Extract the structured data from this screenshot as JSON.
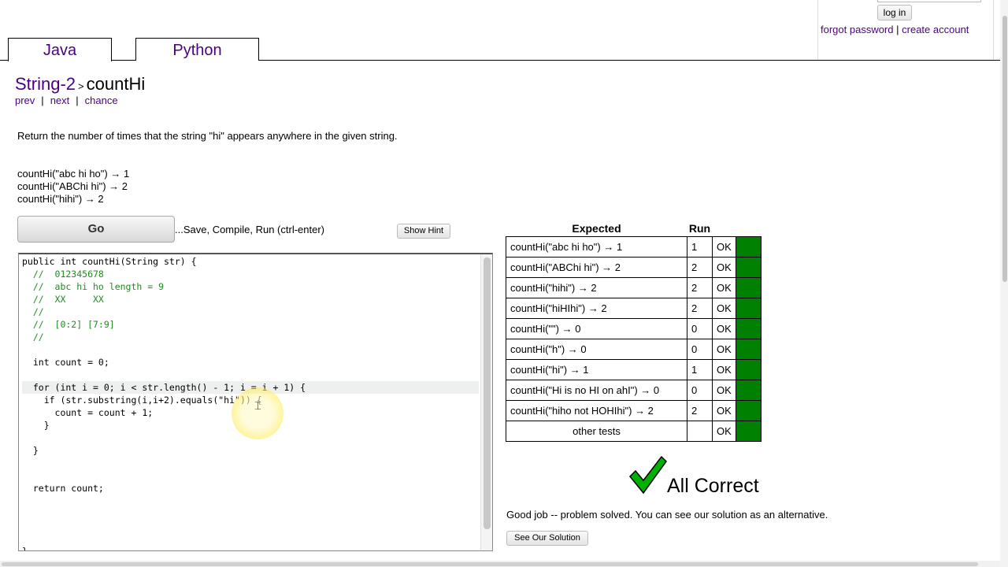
{
  "account": {
    "login_label": "log in",
    "forgot_label": "forgot password",
    "separator": "|",
    "create_label": "create account"
  },
  "tabs": [
    {
      "label": "Java",
      "active": true
    },
    {
      "label": "Python",
      "active": false
    }
  ],
  "problem": {
    "section": "String-2",
    "separator": ">",
    "name": "countHi",
    "nav": {
      "prev": "prev",
      "next": "next",
      "chance": "chance",
      "sep": "|"
    },
    "description": "Return the number of times that the string \"hi\" appears anywhere in the given string.",
    "examples": [
      "countHi(\"abc hi ho\") → 1",
      "countHi(\"ABChi hi\") → 2",
      "countHi(\"hihi\") → 2"
    ]
  },
  "controls": {
    "go_label": "Go",
    "go_hint": "...Save, Compile, Run (ctrl-enter)",
    "show_hint_label": "Show Hint"
  },
  "editor": {
    "lines": [
      "public int countHi(String str) {",
      "  //  012345678",
      "  //  abc hi ho length = 9",
      "  //  XX     XX",
      "  //",
      "  //  [0:2] [7:9]",
      "  //",
      "",
      "  int count = 0;",
      "",
      "  for (int i = 0; i < str.length() - 1; i = i + 1) {",
      "    if (str.substring(i,i+2).equals(\"hi\")) {",
      "      count = count + 1;",
      "    }",
      "",
      "  }",
      "",
      "",
      "  return count;",
      "",
      "",
      "",
      "",
      "}"
    ],
    "active_line": 10
  },
  "results": {
    "headers": {
      "expected": "Expected",
      "run": "Run"
    },
    "rows": [
      {
        "expected": "countHi(\"abc hi ho\") → 1",
        "run": "1",
        "status": "OK"
      },
      {
        "expected": "countHi(\"ABChi hi\") → 2",
        "run": "2",
        "status": "OK"
      },
      {
        "expected": "countHi(\"hihi\") → 2",
        "run": "2",
        "status": "OK"
      },
      {
        "expected": "countHi(\"hiHIhi\") → 2",
        "run": "2",
        "status": "OK"
      },
      {
        "expected": "countHi(\"\") → 0",
        "run": "0",
        "status": "OK"
      },
      {
        "expected": "countHi(\"h\") → 0",
        "run": "0",
        "status": "OK"
      },
      {
        "expected": "countHi(\"hi\") → 1",
        "run": "1",
        "status": "OK"
      },
      {
        "expected": "countHi(\"Hi is no HI on ahI\") → 0",
        "run": "0",
        "status": "OK"
      },
      {
        "expected": "countHi(\"hiho not HOHIhi\") → 2",
        "run": "2",
        "status": "OK"
      },
      {
        "expected": "other tests",
        "run": "",
        "status": "OK"
      }
    ],
    "pass_color": "#008000"
  },
  "verdict": {
    "title": "All Correct",
    "check_color": "#00b000",
    "message": "Good job -- problem solved. You can see our solution as an alternative.",
    "solution_label": "See Our Solution"
  }
}
